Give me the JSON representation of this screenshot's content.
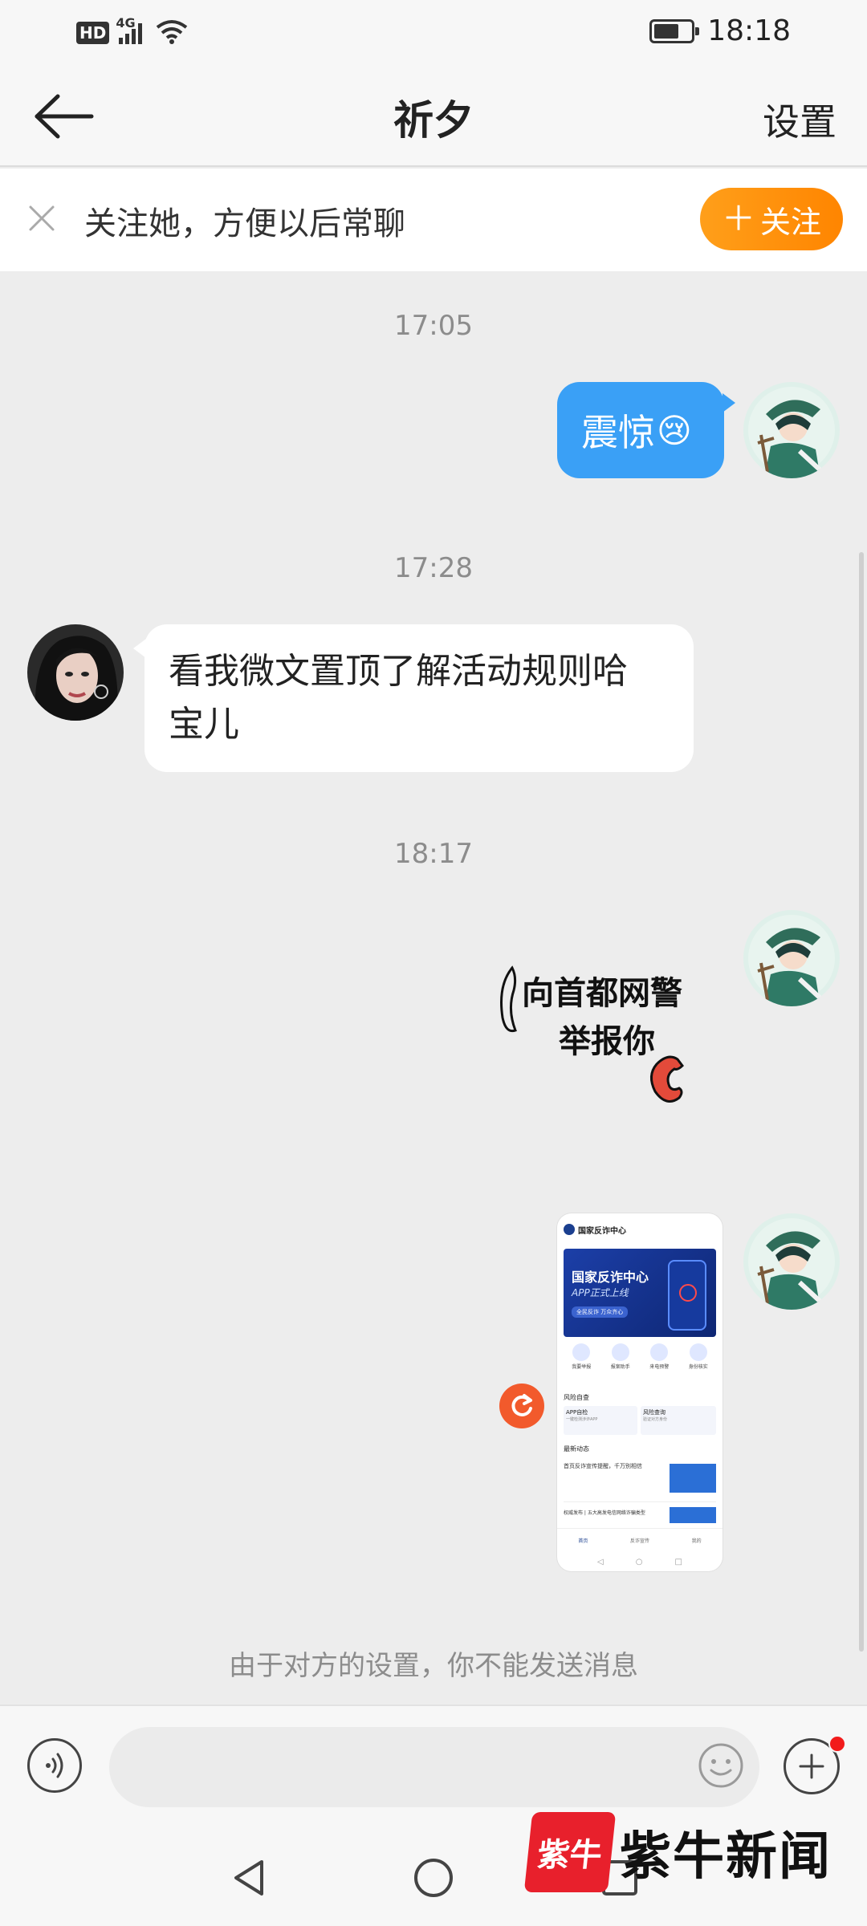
{
  "status_bar": {
    "hd_label": "HD",
    "network_label": "4G",
    "time": "18:18"
  },
  "nav": {
    "title": "祈夕",
    "settings_label": "设置"
  },
  "follow_banner": {
    "text": "关注她，方便以后常聊",
    "follow_button_label": "关注",
    "accent_color": "#ff8f0a"
  },
  "messages": [
    {
      "timestamp": "17:05",
      "side": "right",
      "type": "text",
      "text": "震惊",
      "emoji": "😢"
    },
    {
      "timestamp": "17:28",
      "side": "left",
      "type": "text",
      "lines": [
        "看我微文置顶了解活动规则哈",
        "宝儿"
      ]
    },
    {
      "timestamp": "18:17",
      "side": "right",
      "type": "sticker",
      "sticker_lines": [
        "向首都网警",
        "举报你"
      ]
    },
    {
      "side": "right",
      "type": "image",
      "status": "send-failed",
      "screenshot": {
        "app_title": "国家反诈中心",
        "banner_title": "国家反诈中心",
        "banner_subtitle": "APP正式上线",
        "banner_chip": "全民反诈  万众齐心",
        "quick_actions": [
          "我要举报",
          "报案助手",
          "来电预警",
          "身份核实"
        ],
        "section_risk": "风险自查",
        "risk_cards": [
          "APP自检",
          "风险查询"
        ],
        "risk_card_subs": [
          "一键检测涉诈APP",
          "验证对方身份"
        ],
        "section_news": "最新动态",
        "news_items": [
          "首页反诈宣传提醒，千万别相信",
          "权威发布 | 五大高发电信网络诈骗类型"
        ],
        "tab_labels": [
          "首页",
          "反诈宣传",
          "我的"
        ]
      }
    }
  ],
  "notice": "由于对方的设置，你不能发送消息",
  "input_bar": {
    "voice_icon": "voice-icon",
    "emoji_icon": "smiley-icon",
    "plus_icon": "plus-icon"
  },
  "watermark": {
    "badge_text": "紫牛",
    "text": "紫牛新闻"
  }
}
